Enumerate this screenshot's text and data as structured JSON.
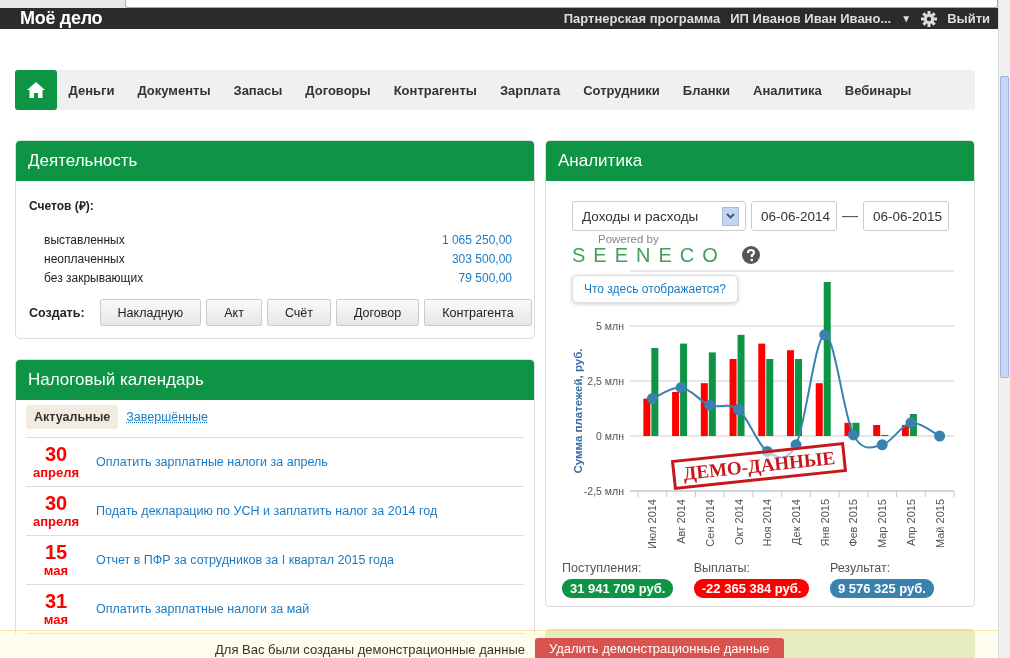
{
  "header": {
    "logo": "Моё дело",
    "partner_link": "Партнерская программа",
    "user_menu": "ИП Иванов Иван Ивано...",
    "user_caret": "▼",
    "logout": "Выйти"
  },
  "nav": {
    "items": [
      "Деньги",
      "Документы",
      "Запасы",
      "Договоры",
      "Контрагенты",
      "Зарплата",
      "Сотрудники",
      "Бланки",
      "Аналитика",
      "Вебинары"
    ]
  },
  "activity": {
    "title": "Деятельность",
    "invoices_label": "Счетов (₽):",
    "rows": [
      {
        "label": "выставленных",
        "amount": "1 065 250,00"
      },
      {
        "label": "неоплаченных",
        "amount": "303 500,00"
      },
      {
        "label": "без закрывающих",
        "amount": "79 500,00"
      }
    ],
    "create_label": "Создать:",
    "create_buttons": [
      "Накладную",
      "Акт",
      "Счёт",
      "Договор",
      "Контрагента"
    ]
  },
  "tax_calendar": {
    "title": "Налоговый календарь",
    "tabs": [
      {
        "label": "Актуальные",
        "selected": true
      },
      {
        "label": "Завершённые",
        "selected": false
      }
    ],
    "events": [
      {
        "day": "30",
        "month": "апреля",
        "task": "Оплатить зарплатные налоги за апрель"
      },
      {
        "day": "30",
        "month": "апреля",
        "task": "Подать декларацию по УСН и заплатить налог за 2014 год"
      },
      {
        "day": "15",
        "month": "мая",
        "task": "Отчет в ПФР за сотрудников за I квартал 2015 года"
      },
      {
        "day": "31",
        "month": "мая",
        "task": "Оплатить зарплатные налоги за май"
      }
    ]
  },
  "analytics": {
    "title": "Аналитика",
    "report_select": "Доходы и расходы",
    "date_from": "06-06-2014",
    "date_separator": "—",
    "date_to": "06-06-2015",
    "powered_by": "Powered by",
    "brand": "SEENECO",
    "help_tooltip": "Что здесь отображается?",
    "stamp": "ДЕМО-ДАННЫЕ",
    "chart_data": {
      "type": "bar",
      "ylabel": "Сумма платежей, руб.",
      "categories": [
        "Июл 2014",
        "Авг 2014",
        "Сен 2014",
        "Окт 2014",
        "Ноя 2014",
        "Дек 2014",
        "Янв 2015",
        "Фев 2015",
        "Мар 2015",
        "Апр 2015",
        "Май 2015"
      ],
      "series": [
        {
          "type": "bar",
          "color": "#ff0000",
          "values": [
            1.7,
            2.0,
            2.4,
            3.5,
            4.2,
            3.9,
            2.4,
            0.6,
            0.5,
            0.5,
            0
          ]
        },
        {
          "type": "bar",
          "color": "#0d9444",
          "values": [
            4.0,
            4.2,
            3.8,
            4.6,
            3.5,
            3.5,
            7.0,
            0.6,
            0.05,
            1.0,
            0
          ]
        },
        {
          "type": "line",
          "color": "#3a82ae",
          "marker": true,
          "values": [
            1.7,
            2.2,
            1.4,
            1.2,
            -0.7,
            -0.4,
            4.6,
            0.05,
            -0.4,
            0.6,
            0
          ]
        }
      ],
      "ylim": [
        -2.5,
        7.5
      ],
      "grid": true,
      "yticks": [
        {
          "value": -2.5,
          "label": "-2,5 млн"
        },
        {
          "value": 0,
          "label": "0 млн"
        },
        {
          "value": 2.5,
          "label": "2,5 млн"
        },
        {
          "value": 5,
          "label": "5 млн"
        }
      ]
    },
    "totals": [
      {
        "label": "Поступления:",
        "value": "31 941 709 руб.",
        "color": "#0d9444"
      },
      {
        "label": "Выплаты:",
        "value": "-22 365 384 руб.",
        "color": "#ff0000"
      },
      {
        "label": "Результат:",
        "value": "9 576 325 руб.",
        "color": "#3a82ae"
      }
    ]
  },
  "demo_banner": {
    "message": "Для Вас были созданы демонстрационные данные",
    "button": "Удалить демонстрационные данные"
  }
}
